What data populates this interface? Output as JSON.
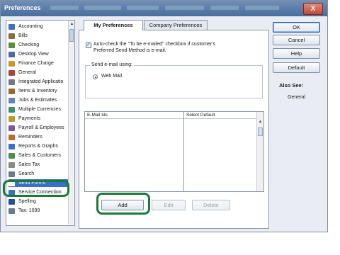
{
  "window": {
    "title": "Preferences",
    "close_label": "X"
  },
  "sidebar": {
    "items": [
      {
        "label": "Accounting",
        "icon": "accounting-icon",
        "color": "#3b6fc9"
      },
      {
        "label": "Bills",
        "icon": "bills-icon",
        "color": "#8a6d3b"
      },
      {
        "label": "Checking",
        "icon": "checking-icon",
        "color": "#5a8f3a"
      },
      {
        "label": "Desktop View",
        "icon": "desktop-view-icon",
        "color": "#4a6d9c"
      },
      {
        "label": "Finance Charge",
        "icon": "finance-charge-icon",
        "color": "#c79a2f"
      },
      {
        "label": "General",
        "icon": "general-icon",
        "color": "#b0433a"
      },
      {
        "label": "Integrated Applicatio",
        "icon": "integrated-applications-icon",
        "color": "#6b7a8f"
      },
      {
        "label": "Items & Inventory",
        "icon": "items-inventory-icon",
        "color": "#9a6a2a"
      },
      {
        "label": "Jobs & Estimates",
        "icon": "jobs-estimates-icon",
        "color": "#5b86c4"
      },
      {
        "label": "Multiple Currencies",
        "icon": "multiple-currencies-icon",
        "color": "#3d8f6e"
      },
      {
        "label": "Payments",
        "icon": "payments-icon",
        "color": "#c29a2a"
      },
      {
        "label": "Payroll & Employees",
        "icon": "payroll-employees-icon",
        "color": "#7a5a9a"
      },
      {
        "label": "Reminders",
        "icon": "reminders-icon",
        "color": "#c26a2a"
      },
      {
        "label": "Reports & Graphs",
        "icon": "reports-graphs-icon",
        "color": "#3b6fc9"
      },
      {
        "label": "Sales & Customers",
        "icon": "sales-customers-icon",
        "color": "#4a8f4a"
      },
      {
        "label": "Sales Tax",
        "icon": "sales-tax-icon",
        "color": "#8a8a8a"
      },
      {
        "label": "Search",
        "icon": "search-icon",
        "color": "#6b7a8f"
      },
      {
        "label": "Send Forms",
        "icon": "send-forms-icon",
        "color": "#ffffff",
        "selected": true
      },
      {
        "label": "Service Connection",
        "icon": "service-connection-icon",
        "color": "#3b6fc9"
      },
      {
        "label": "Spelling",
        "icon": "spelling-icon",
        "color": "#2a4f9a"
      },
      {
        "label": "Tax: 1099",
        "icon": "tax-1099-icon",
        "color": "#6b7a8f"
      }
    ]
  },
  "tabs": [
    {
      "label": "My Preferences",
      "active": true
    },
    {
      "label": "Company Preferences",
      "active": false
    }
  ],
  "my_preferences": {
    "auto_check_text": "Auto-check the \"To be e-mailed\" checkbox if customer's Preferred Send Method is e-mail.",
    "auto_check_checked": true,
    "send_email_legend": "Send e-mail using:",
    "send_email_option": "Web Mail",
    "table": {
      "columns": [
        "E-Mail Ids",
        "Select Default"
      ],
      "rows": []
    },
    "buttons": {
      "add": "Add",
      "edit": "Edit",
      "delete": "Delete"
    }
  },
  "right_buttons": {
    "ok": "OK",
    "cancel": "Cancel",
    "help": "Help",
    "default": "Default"
  },
  "also_see": {
    "title": "Also See:",
    "links": [
      "General"
    ]
  },
  "colors": {
    "highlight": "#1a7a3a",
    "selection": "#3b6fc9",
    "titlebar": "#4a6d9c"
  }
}
